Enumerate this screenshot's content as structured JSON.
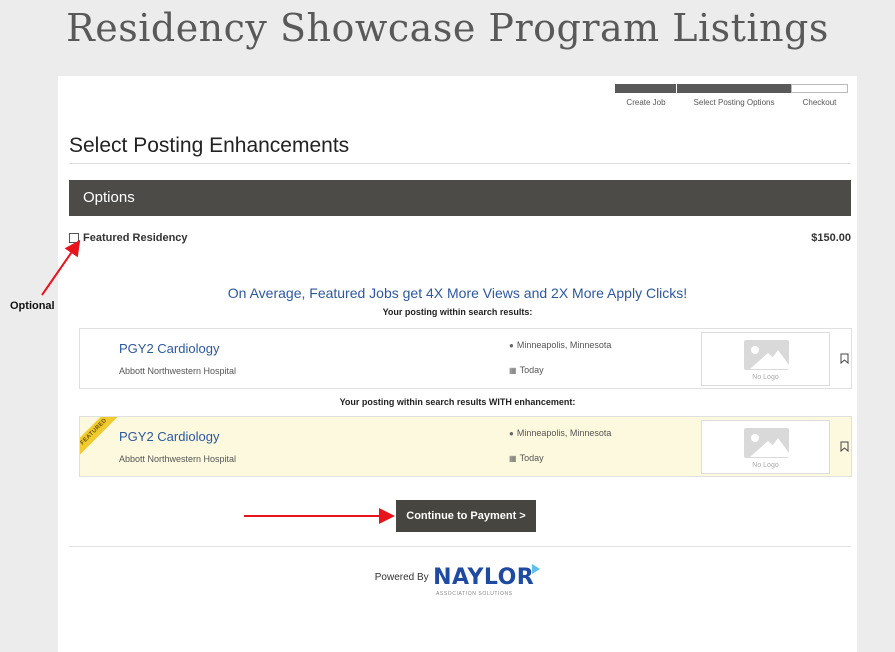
{
  "slide_title": "Residency Showcase Program Listings",
  "steps": [
    {
      "label": "Create Job",
      "state": "complete"
    },
    {
      "label": "Select Posting Options",
      "state": "current"
    },
    {
      "label": "Checkout",
      "state": "pending"
    }
  ],
  "section_title": "Select Posting Enhancements",
  "options_header": "Options",
  "featured_option": {
    "label": "Featured Residency",
    "price": "$150.00",
    "checked": false
  },
  "promo_text": "On Average, Featured Jobs get 4X More Views and 2X More Apply Clicks!",
  "preview_heading": "Your posting within search results:",
  "enhanced_heading": "Your posting within search results WITH enhancement:",
  "job": {
    "title": "PGY2 Cardiology",
    "organization": "Abbott Northwestern Hospital",
    "location": "Minneapolis, Minnesota",
    "date": "Today",
    "logo_caption": "No Logo"
  },
  "featured_ribbon": "FEATURED",
  "continue_button": "Continue to Payment >",
  "footer": {
    "powered_by": "Powered By",
    "brand": "NAYLOR",
    "brand_tagline": "ASSOCIATION SOLUTIONS"
  },
  "annotation": {
    "label": "Optional"
  },
  "colors": {
    "accent_blue": "#2c58a0",
    "header_dark": "#4c4b48",
    "annotation_red": "#e8141b",
    "featured_bg": "#fdf9df",
    "ribbon_yellow": "#f1cb2e"
  }
}
